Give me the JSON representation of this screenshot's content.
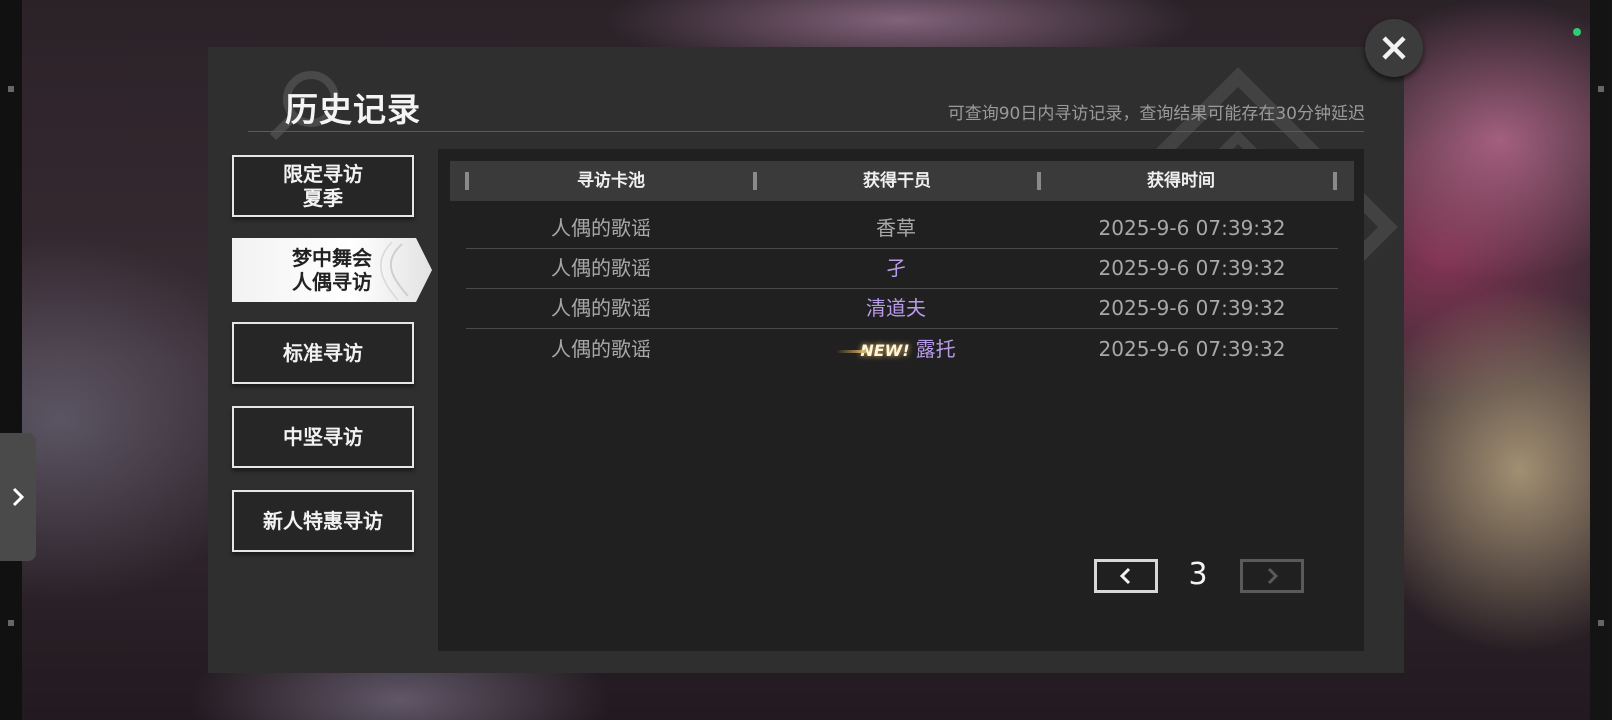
{
  "dialog": {
    "title": "历史记录",
    "notice": "可查询90日内寻访记录，查询结果可能存在30分钟延迟"
  },
  "categories": [
    {
      "line1": "限定寻访",
      "line2": "夏季",
      "active": false
    },
    {
      "line1": "梦中舞会",
      "line2": "人偶寻访",
      "active": true
    },
    {
      "line1": "标准寻访",
      "line2": "",
      "active": false
    },
    {
      "line1": "中坚寻访",
      "line2": "",
      "active": false
    },
    {
      "line1": "新人特惠寻访",
      "line2": "",
      "active": false
    }
  ],
  "table": {
    "headers": [
      "寻访卡池",
      "获得干员",
      "获得时间"
    ],
    "rows": [
      {
        "pool": "人偶的歌谣",
        "operator": "香草",
        "time": "2025-9-6 07:39:32",
        "new": false
      },
      {
        "pool": "人偶的歌谣",
        "operator": "孑",
        "time": "2025-9-6 07:39:32",
        "new": false
      },
      {
        "pool": "人偶的歌谣",
        "operator": "清道夫",
        "time": "2025-9-6 07:39:32",
        "new": false
      },
      {
        "pool": "人偶的歌谣",
        "operator": "露托",
        "time": "2025-9-6 07:39:32",
        "new": true
      }
    ],
    "new_badge": "NEW!"
  },
  "pagination": {
    "current": "3",
    "prev_icon": "chevron-left-icon",
    "next_icon": "chevron-right-icon",
    "next_disabled": true
  },
  "close_icon": "close-icon",
  "colors": {
    "rarity_4": "#b89be8",
    "rarity_3": "#a8a8a8",
    "panel": "#202020",
    "dialog": "#2f2f2f"
  }
}
